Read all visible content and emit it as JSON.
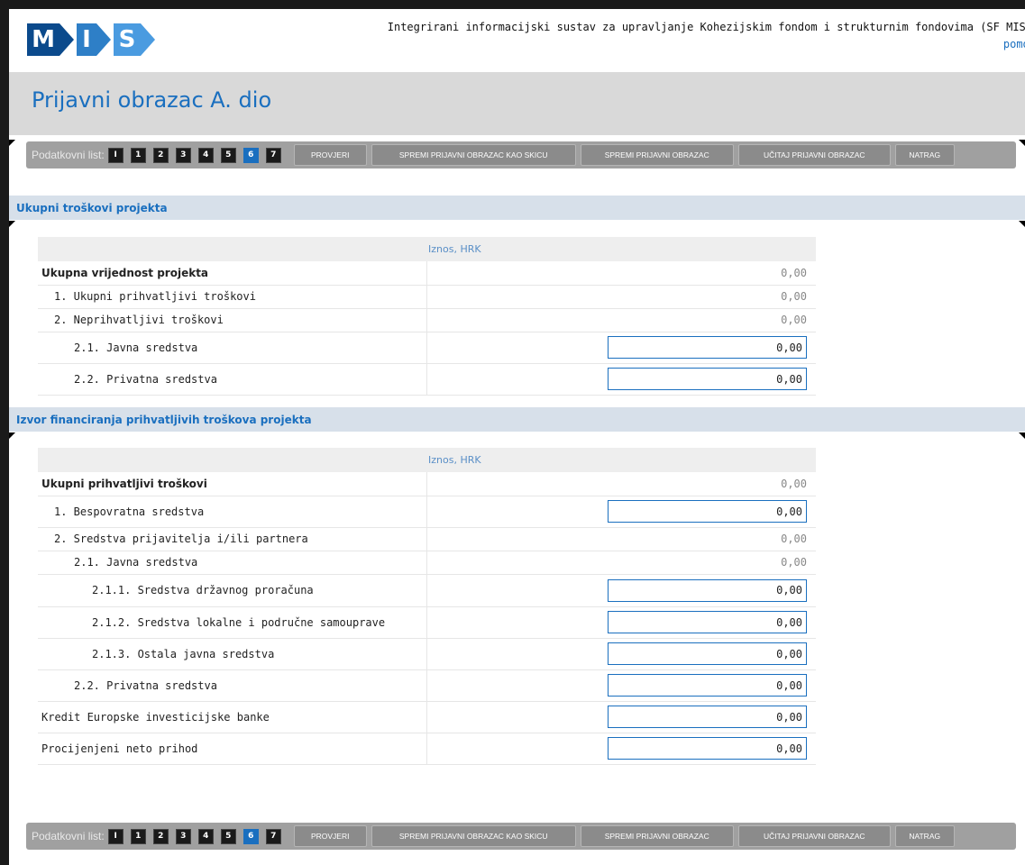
{
  "topbar": {
    "system_title": "Integrirani informacijski sustav za upravljanje Kohezijskim fondom i strukturnim fondovima (SF MIS)",
    "help_link": "pomoć",
    "logo": {
      "m": "M",
      "i": "I",
      "s": "S"
    }
  },
  "page": {
    "title": "Prijavni obrazac A. dio"
  },
  "nav": {
    "label": "Podatkovni list:",
    "pages": [
      "I",
      "1",
      "2",
      "3",
      "4",
      "5",
      "6",
      "7"
    ],
    "active_page": "6",
    "buttons": {
      "check": "PROVJERI",
      "save_draft": "SPREMI PRIJAVNI OBRAZAC KAO SKICU",
      "save": "SPREMI PRIJAVNI OBRAZAC",
      "load": "UČITAJ PRIJAVNI OBRAZAC",
      "back": "NATRAG"
    }
  },
  "section1": {
    "title": "Ukupni troškovi projekta",
    "column_header": "Iznos, HRK",
    "rows": [
      {
        "label": "Ukupna vrijednost projekta",
        "value": "0,00"
      },
      {
        "label": "1. Ukupni prihvatljivi troškovi",
        "value": "0,00"
      },
      {
        "label": "2. Neprihvatljivi troškovi",
        "value": "0,00"
      },
      {
        "label": "2.1. Javna sredstva",
        "value": "0,00"
      },
      {
        "label": "2.2. Privatna sredstva",
        "value": "0,00"
      }
    ]
  },
  "section2": {
    "title": "Izvor financiranja prihvatljivih troškova projekta",
    "column_header": "Iznos, HRK",
    "rows": [
      {
        "label": "Ukupni prihvatljivi troškovi",
        "value": "0,00"
      },
      {
        "label": "1. Bespovratna sredstva",
        "value": "0,00"
      },
      {
        "label": "2. Sredstva prijavitelja i/ili partnera",
        "value": "0,00"
      },
      {
        "label": "2.1. Javna sredstva",
        "value": "0,00"
      },
      {
        "label": "2.1.1. Sredstva državnog proračuna",
        "value": "0,00"
      },
      {
        "label": "2.1.2. Sredstva lokalne i područne samouprave",
        "value": "0,00"
      },
      {
        "label": "2.1.3. Ostala javna sredstva",
        "value": "0,00"
      },
      {
        "label": "2.2. Privatna sredstva",
        "value": "0,00"
      },
      {
        "label": "Kredit Europske investicijske banke",
        "value": "0,00"
      },
      {
        "label": "Procijenjeni neto prihod",
        "value": "0,00"
      }
    ]
  },
  "colors": {
    "accent": "#1a6fbf",
    "header_band": "#d9d9d9",
    "section_band": "#d7e0ea",
    "nav_bar": "#a0a0a0"
  }
}
